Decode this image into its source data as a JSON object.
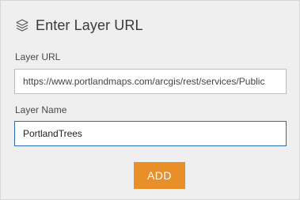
{
  "header": {
    "icon": "layers-icon",
    "title": "Enter Layer URL"
  },
  "form": {
    "layer_url": {
      "label": "Layer URL",
      "value": "https://www.portlandmaps.com/arcgis/rest/services/Public"
    },
    "layer_name": {
      "label": "Layer Name",
      "value": "PortlandTrees"
    },
    "add_button_label": "ADD"
  },
  "colors": {
    "panel_background": "#efefef",
    "accent_button": "#e88f2a",
    "focused_input_border": "#2e6db4"
  }
}
